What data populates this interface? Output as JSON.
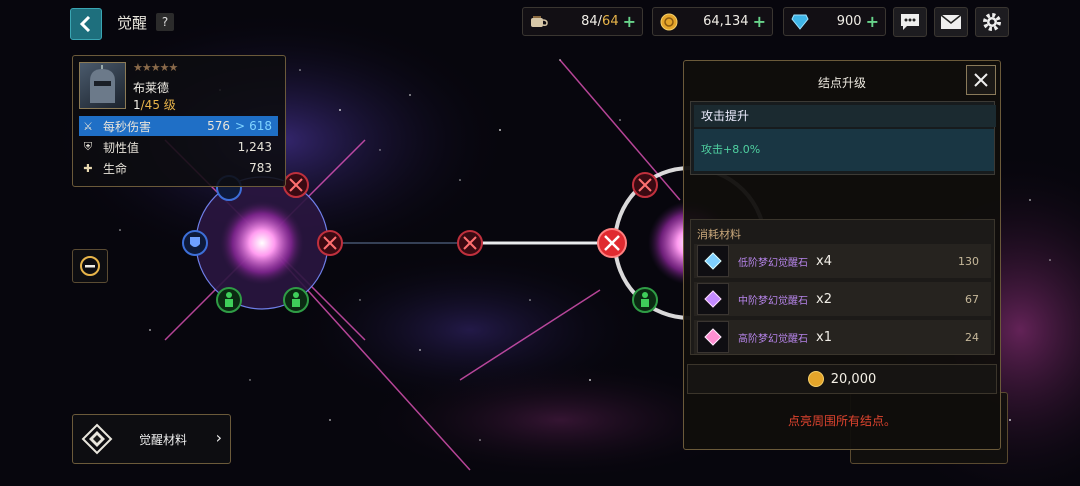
{
  "header": {
    "title": "觉醒",
    "help_label": "?",
    "stamina": {
      "current": "84",
      "separator": "/",
      "max": "64",
      "icon": "coffee-cup-icon"
    },
    "gold": {
      "value": "64,134",
      "icon": "gold-coin-icon"
    },
    "diamonds": {
      "value": "900",
      "icon": "diamond-icon"
    },
    "plus": "+",
    "buttons": [
      "chat-icon",
      "mail-icon",
      "settings-gear-icon"
    ]
  },
  "hero": {
    "stars": "★★★★★",
    "name": "布莱德",
    "level": "1",
    "level_max": "/45 级",
    "stats": [
      {
        "label": "每秒伤害",
        "value": "576",
        "arrow": ">",
        "new_value": "618",
        "icon": "crossed-swords-icon"
      },
      {
        "label": "韧性值",
        "value": "1,243",
        "icon": "shield-icon"
      },
      {
        "label": "生命",
        "value": "783",
        "icon": "health-cross-icon"
      }
    ]
  },
  "side": {
    "materials_label": "觉醒材料",
    "chevron": "›"
  },
  "panel": {
    "title": "结点升级",
    "close": "✕",
    "upgrade_name": "攻击提升",
    "upgrade_effect_label": "攻击",
    "upgrade_effect_value": "+8.0%",
    "materials_title": "消耗材料",
    "materials": [
      {
        "name": "低阶梦幻觉醒石",
        "qty": "x4",
        "count": "130",
        "color": "#7fd0ff"
      },
      {
        "name": "中阶梦幻觉醒石",
        "qty": "x2",
        "count": "67",
        "color": "#c48bff"
      },
      {
        "name": "高阶梦幻觉醒石",
        "qty": "x1",
        "count": "24",
        "color": "#ff8fd2"
      }
    ],
    "cost": "20,000",
    "note": "点亮周围所有结点。"
  },
  "colors": {
    "accent": "#1f6fc6",
    "gold": "#e7b44a",
    "red": "#e0442f",
    "green": "#4fd0a0"
  }
}
